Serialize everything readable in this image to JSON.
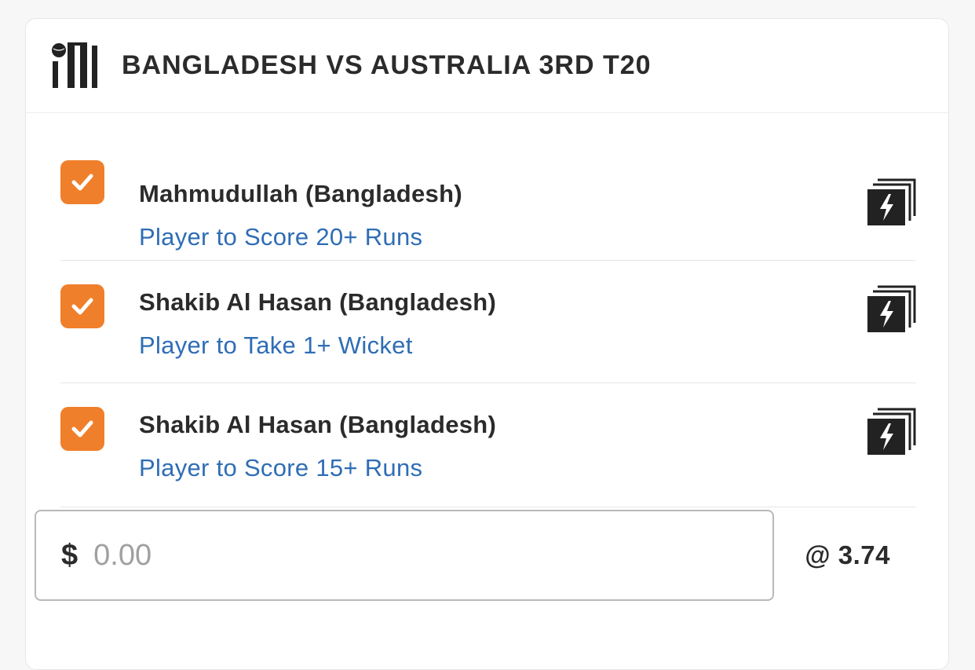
{
  "header": {
    "title": "BANGLADESH VS AUSTRALIA 3RD T20",
    "icon": "cricket-icon"
  },
  "selections": [
    {
      "player": "Mahmudullah (Bangladesh)",
      "market": "Player to Score 20+ Runs",
      "checked": true,
      "icon": "boost-icon"
    },
    {
      "player": "Shakib Al Hasan (Bangladesh)",
      "market": "Player to Take 1+ Wicket",
      "checked": true,
      "icon": "boost-icon"
    },
    {
      "player": "Shakib Al Hasan (Bangladesh)",
      "market": "Player to Score 15+ Runs",
      "checked": true,
      "icon": "boost-icon"
    }
  ],
  "stake": {
    "currency": "$",
    "placeholder": "0.00",
    "odds": "@ 3.74"
  },
  "colors": {
    "checkbox": "#f07f2b",
    "market_text": "#2f6db5",
    "title_text": "#2b2b2b"
  }
}
